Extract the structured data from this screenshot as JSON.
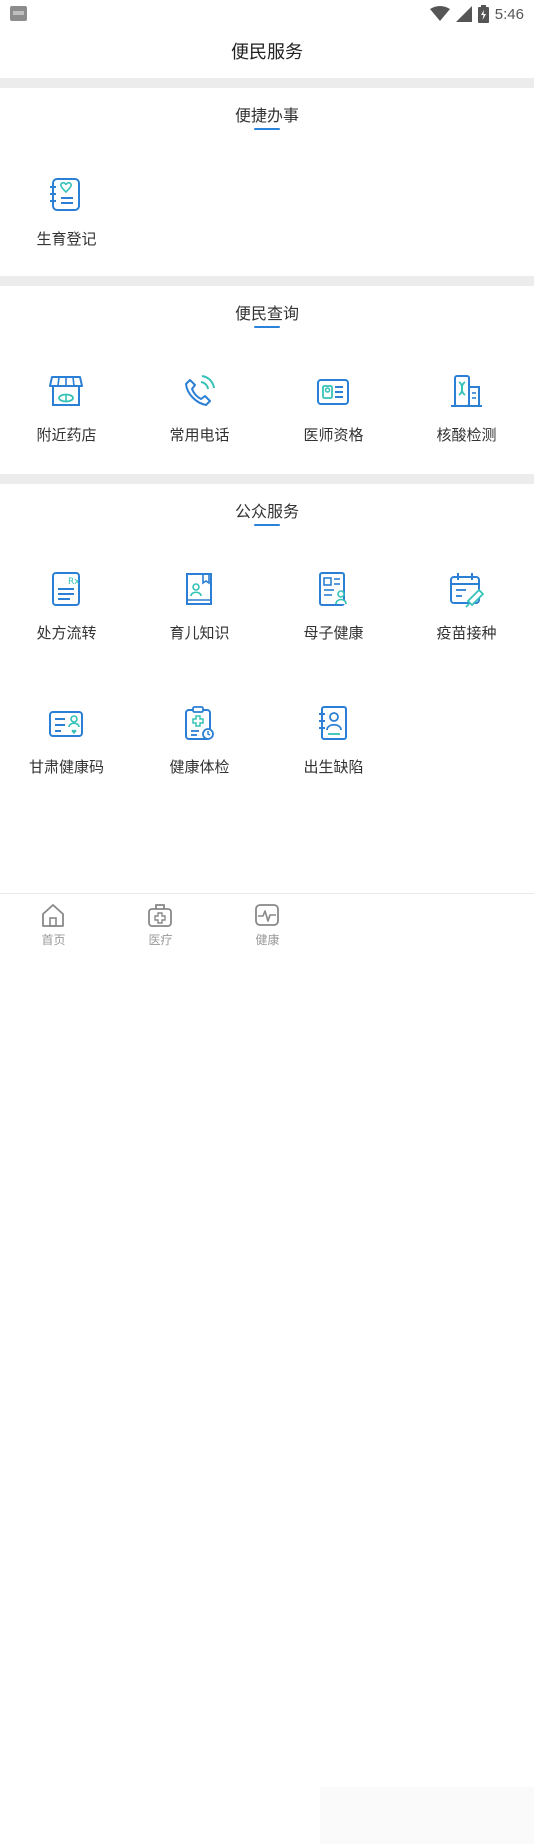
{
  "status_bar": {
    "time": "5:46"
  },
  "header": {
    "title": "便民服务"
  },
  "sections": [
    {
      "title": "便捷办事",
      "items": [
        {
          "label": "生育登记",
          "icon": "heart-document-icon"
        }
      ]
    },
    {
      "title": "便民查询",
      "items": [
        {
          "label": "附近药店",
          "icon": "pharmacy-icon"
        },
        {
          "label": "常用电话",
          "icon": "phone-icon"
        },
        {
          "label": "医师资格",
          "icon": "id-card-icon"
        },
        {
          "label": "核酸检测",
          "icon": "dna-building-icon"
        }
      ]
    },
    {
      "title": "公众服务",
      "items": [
        {
          "label": "处方流转",
          "icon": "prescription-icon"
        },
        {
          "label": "育儿知识",
          "icon": "book-icon"
        },
        {
          "label": "母子健康",
          "icon": "mother-child-icon"
        },
        {
          "label": "疫苗接种",
          "icon": "vaccine-calendar-icon"
        },
        {
          "label": "甘肃健康码",
          "icon": "health-code-card-icon"
        },
        {
          "label": "健康体检",
          "icon": "checkup-clipboard-icon"
        },
        {
          "label": "出生缺陷",
          "icon": "birth-defect-icon"
        }
      ]
    }
  ],
  "tabbar": [
    {
      "label": "首页",
      "icon": "home-icon"
    },
    {
      "label": "医疗",
      "icon": "medical-kit-icon"
    },
    {
      "label": "健康",
      "icon": "heartbeat-icon"
    }
  ],
  "colors": {
    "accent": "#2b82d9",
    "icon_blue": "#2b7fd4",
    "icon_teal": "#35c2b8"
  }
}
